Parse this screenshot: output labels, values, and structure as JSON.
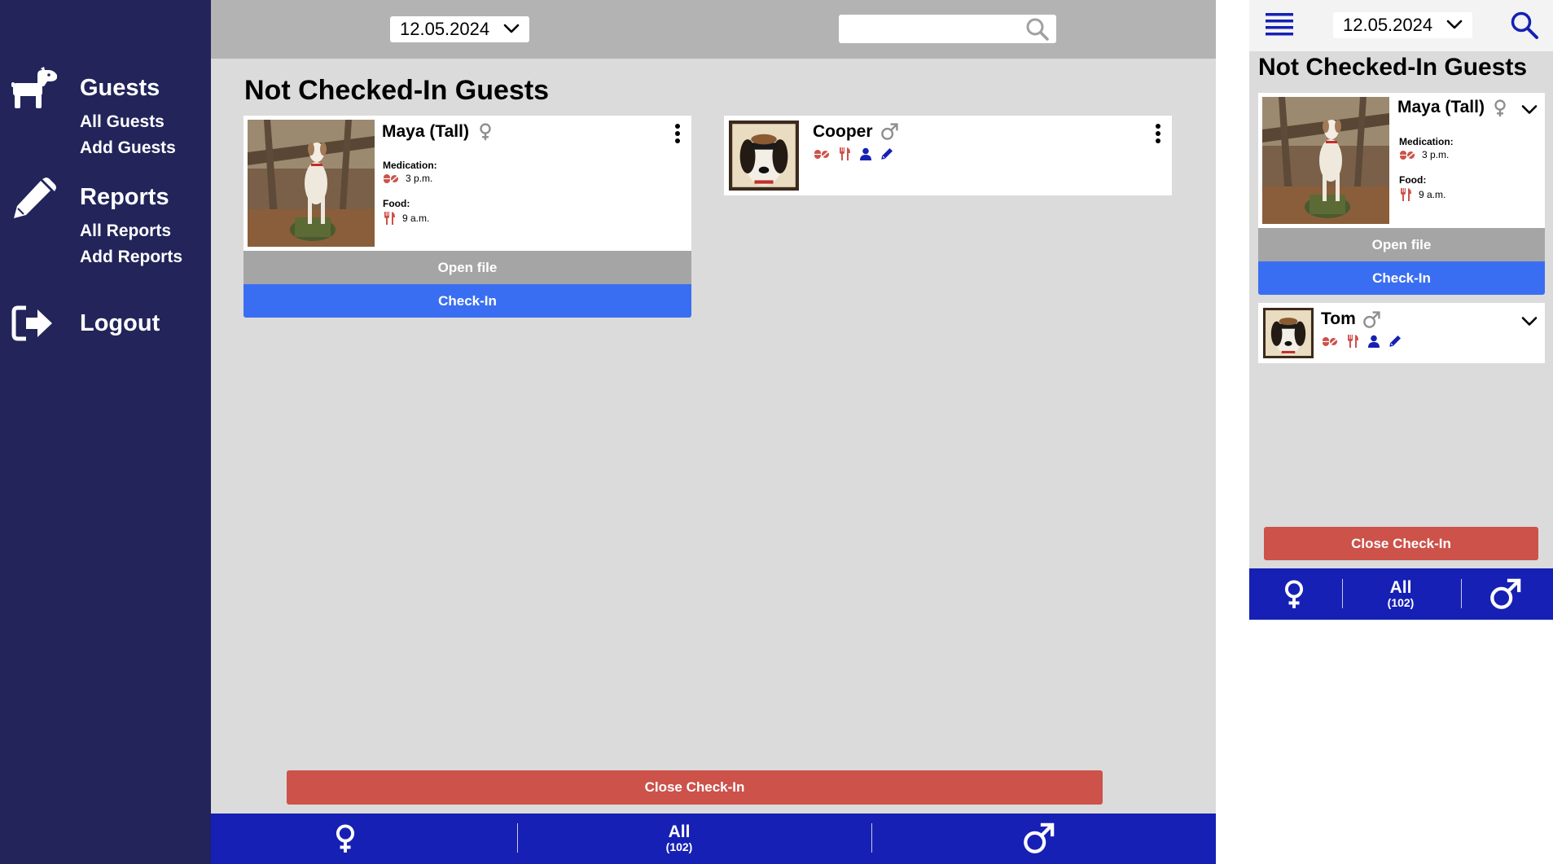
{
  "sidebar": {
    "guests": {
      "title": "Guests",
      "icon": "dog-icon",
      "items": [
        "All Guests",
        "Add Guests"
      ]
    },
    "reports": {
      "title": "Reports",
      "icon": "pencil-icon",
      "items": [
        "All Reports",
        "Add Reports"
      ]
    },
    "logout": {
      "title": "Logout",
      "icon": "logout-icon"
    }
  },
  "desktop": {
    "date": "12.05.2024",
    "search": {
      "placeholder": ""
    },
    "title": "Not Checked-In Guests",
    "guests": [
      {
        "name": "Maya (Tall)",
        "gender": "female",
        "medication_label": "Medication:",
        "medication_time": "3 p.m.",
        "food_label": "Food:",
        "food_time": "9 a.m.",
        "open_label": "Open file",
        "checkin_label": "Check-In"
      },
      {
        "name": "Cooper",
        "gender": "male",
        "icons": [
          "pills-icon",
          "cutlery-icon",
          "person-icon",
          "pencil-icon"
        ]
      }
    ],
    "close_label": "Close Check-In",
    "filter": {
      "all_label": "All",
      "count": "(102)"
    }
  },
  "mobile": {
    "date": "12.05.2024",
    "title": "Not Checked-In Guests",
    "guests": [
      {
        "name": "Maya (Tall)",
        "gender": "female",
        "medication_label": "Medication:",
        "medication_time": "3 p.m.",
        "food_label": "Food:",
        "food_time": "9 a.m.",
        "open_label": "Open file",
        "checkin_label": "Check-In"
      },
      {
        "name": "Tom",
        "gender": "male",
        "icons": [
          "pills-icon",
          "cutlery-icon",
          "person-icon",
          "pencil-icon"
        ]
      }
    ],
    "close_label": "Close Check-In",
    "filter": {
      "all_label": "All",
      "count": "(102)"
    }
  },
  "colors": {
    "sidebar": "#22245a",
    "topbar": "#b3b3b3",
    "background": "#dbdbdb",
    "open_button": "#a5a5a5",
    "checkin_button": "#3a6ef2",
    "close_button": "#cc524a",
    "bottom_bar": "#1620b4",
    "accent_icon": "#1620b4",
    "warning_icon": "#cc524a"
  }
}
